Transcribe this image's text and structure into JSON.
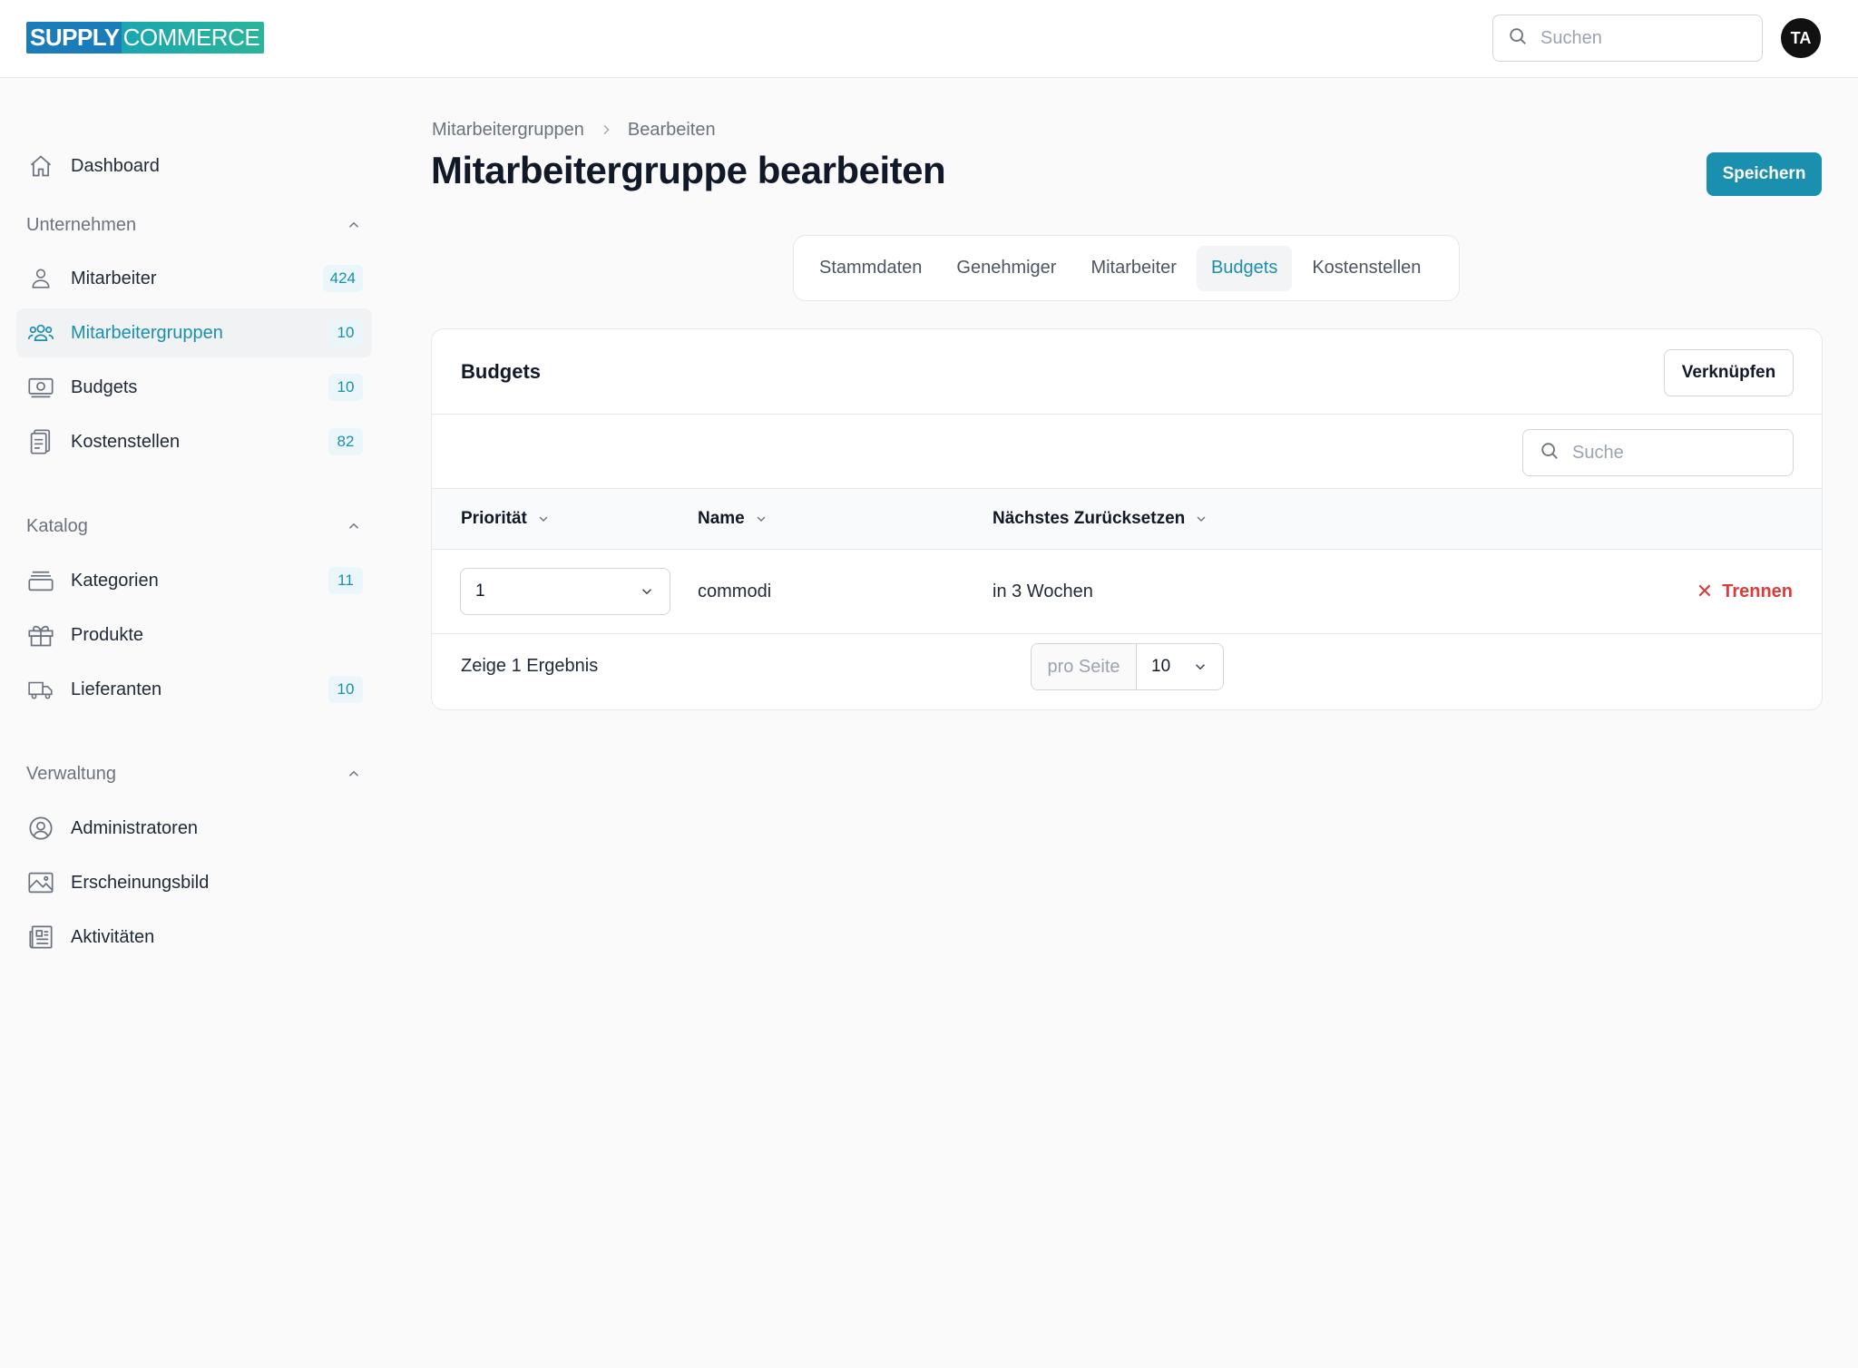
{
  "brand": {
    "part1": "SUPPLY",
    "part2": "COMMERCE"
  },
  "header": {
    "search_placeholder": "Suchen",
    "avatar_initials": "TA"
  },
  "sidebar": {
    "dashboard": "Dashboard",
    "sections": {
      "company": {
        "title": "Unternehmen",
        "items": [
          {
            "label": "Mitarbeiter",
            "count": "424",
            "icon": "user-icon"
          },
          {
            "label": "Mitarbeitergruppen",
            "count": "10",
            "icon": "users-group-icon",
            "active": true
          },
          {
            "label": "Budgets",
            "count": "10",
            "icon": "money-icon"
          },
          {
            "label": "Kostenstellen",
            "count": "82",
            "icon": "clipboard-icon"
          }
        ]
      },
      "catalog": {
        "title": "Katalog",
        "items": [
          {
            "label": "Kategorien",
            "count": "11",
            "icon": "tray-icon"
          },
          {
            "label": "Produkte",
            "count": "",
            "icon": "gift-icon"
          },
          {
            "label": "Lieferanten",
            "count": "10",
            "icon": "truck-icon"
          }
        ]
      },
      "admin": {
        "title": "Verwaltung",
        "items": [
          {
            "label": "Administratoren",
            "icon": "user-circle-icon"
          },
          {
            "label": "Erscheinungsbild",
            "icon": "image-icon"
          },
          {
            "label": "Aktivitäten",
            "icon": "newspaper-icon"
          }
        ]
      }
    }
  },
  "breadcrumb": {
    "parent": "Mitarbeitergruppen",
    "current": "Bearbeiten"
  },
  "page": {
    "title": "Mitarbeitergruppe bearbeiten",
    "save_label": "Speichern"
  },
  "tabs": [
    {
      "label": "Stammdaten"
    },
    {
      "label": "Genehmiger"
    },
    {
      "label": "Mitarbeiter"
    },
    {
      "label": "Budgets",
      "active": true
    },
    {
      "label": "Kostenstellen"
    }
  ],
  "card": {
    "title": "Budgets",
    "link_button": "Verknüpfen",
    "search_placeholder": "Suche",
    "columns": [
      "Priorität",
      "Name",
      "Nächstes Zurücksetzen"
    ],
    "rows": [
      {
        "priority": "1",
        "name": "commodi",
        "next_reset": "in 3 Wochen",
        "action": "Trennen"
      }
    ],
    "result_text": "Zeige 1 Ergebnis",
    "per_page_label": "pro Seite",
    "per_page_value": "10"
  },
  "colors": {
    "accent": "#1a8fae",
    "danger": "#dc3b3b",
    "badge_bg": "#eaf6fa"
  }
}
